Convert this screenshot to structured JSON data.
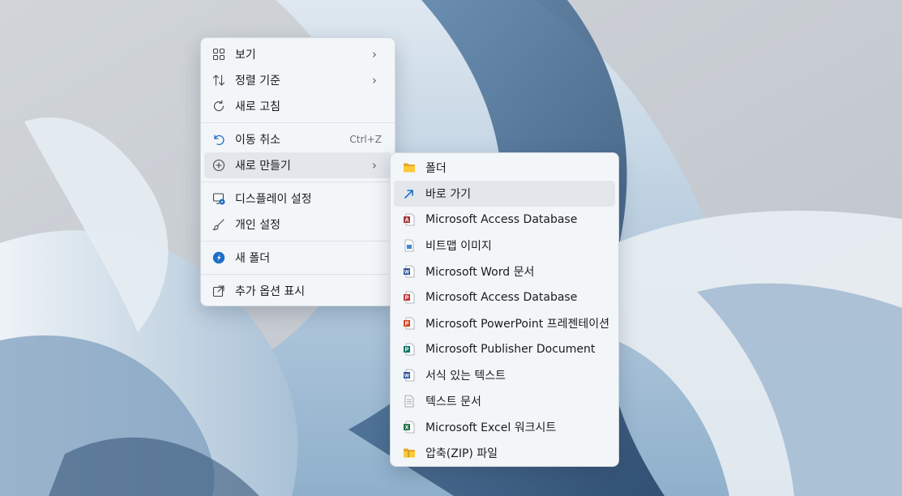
{
  "context_menu": {
    "items": [
      {
        "label": "보기",
        "icon": "view-grid-icon"
      },
      {
        "label": "정렬 기준",
        "icon": "sort-icon"
      },
      {
        "label": "새로 고침",
        "icon": "refresh-icon"
      },
      {
        "label": "이동 취소",
        "accel": "Ctrl+Z",
        "icon": "undo-icon"
      },
      {
        "label": "새로 만들기",
        "icon": "new-icon"
      },
      {
        "label": "디스플레이 설정",
        "icon": "display-settings-icon"
      },
      {
        "label": "개인 설정",
        "icon": "brush-icon"
      },
      {
        "label": "새 폴더",
        "icon": "new-folder-icon"
      },
      {
        "label": "추가 옵션 표시",
        "icon": "more-options-icon"
      }
    ]
  },
  "submenu": {
    "items": [
      {
        "label": "폴더",
        "icon": "folder-icon"
      },
      {
        "label": "바로 가기",
        "icon": "shortcut-icon"
      },
      {
        "label": "Microsoft Access Database",
        "icon": "access-icon"
      },
      {
        "label": "비트맵 이미지",
        "icon": "bitmap-icon"
      },
      {
        "label": "Microsoft Word 문서",
        "icon": "word-icon"
      },
      {
        "label": "Microsoft Access Database",
        "icon": "access-icon"
      },
      {
        "label": "Microsoft PowerPoint 프레젠테이션",
        "icon": "powerpoint-icon"
      },
      {
        "label": "Microsoft Publisher Document",
        "icon": "publisher-icon"
      },
      {
        "label": "서식 있는 텍스트",
        "icon": "rich-text-icon"
      },
      {
        "label": "텍스트 문서",
        "icon": "text-document-icon"
      },
      {
        "label": "Microsoft Excel 워크시트",
        "icon": "excel-icon"
      },
      {
        "label": "압축(ZIP) 파일",
        "icon": "zip-icon"
      }
    ]
  },
  "colors": {
    "accent": "#0067c0",
    "menu_bg": "#f3f6f9",
    "highlight": "#e3e7ec"
  }
}
